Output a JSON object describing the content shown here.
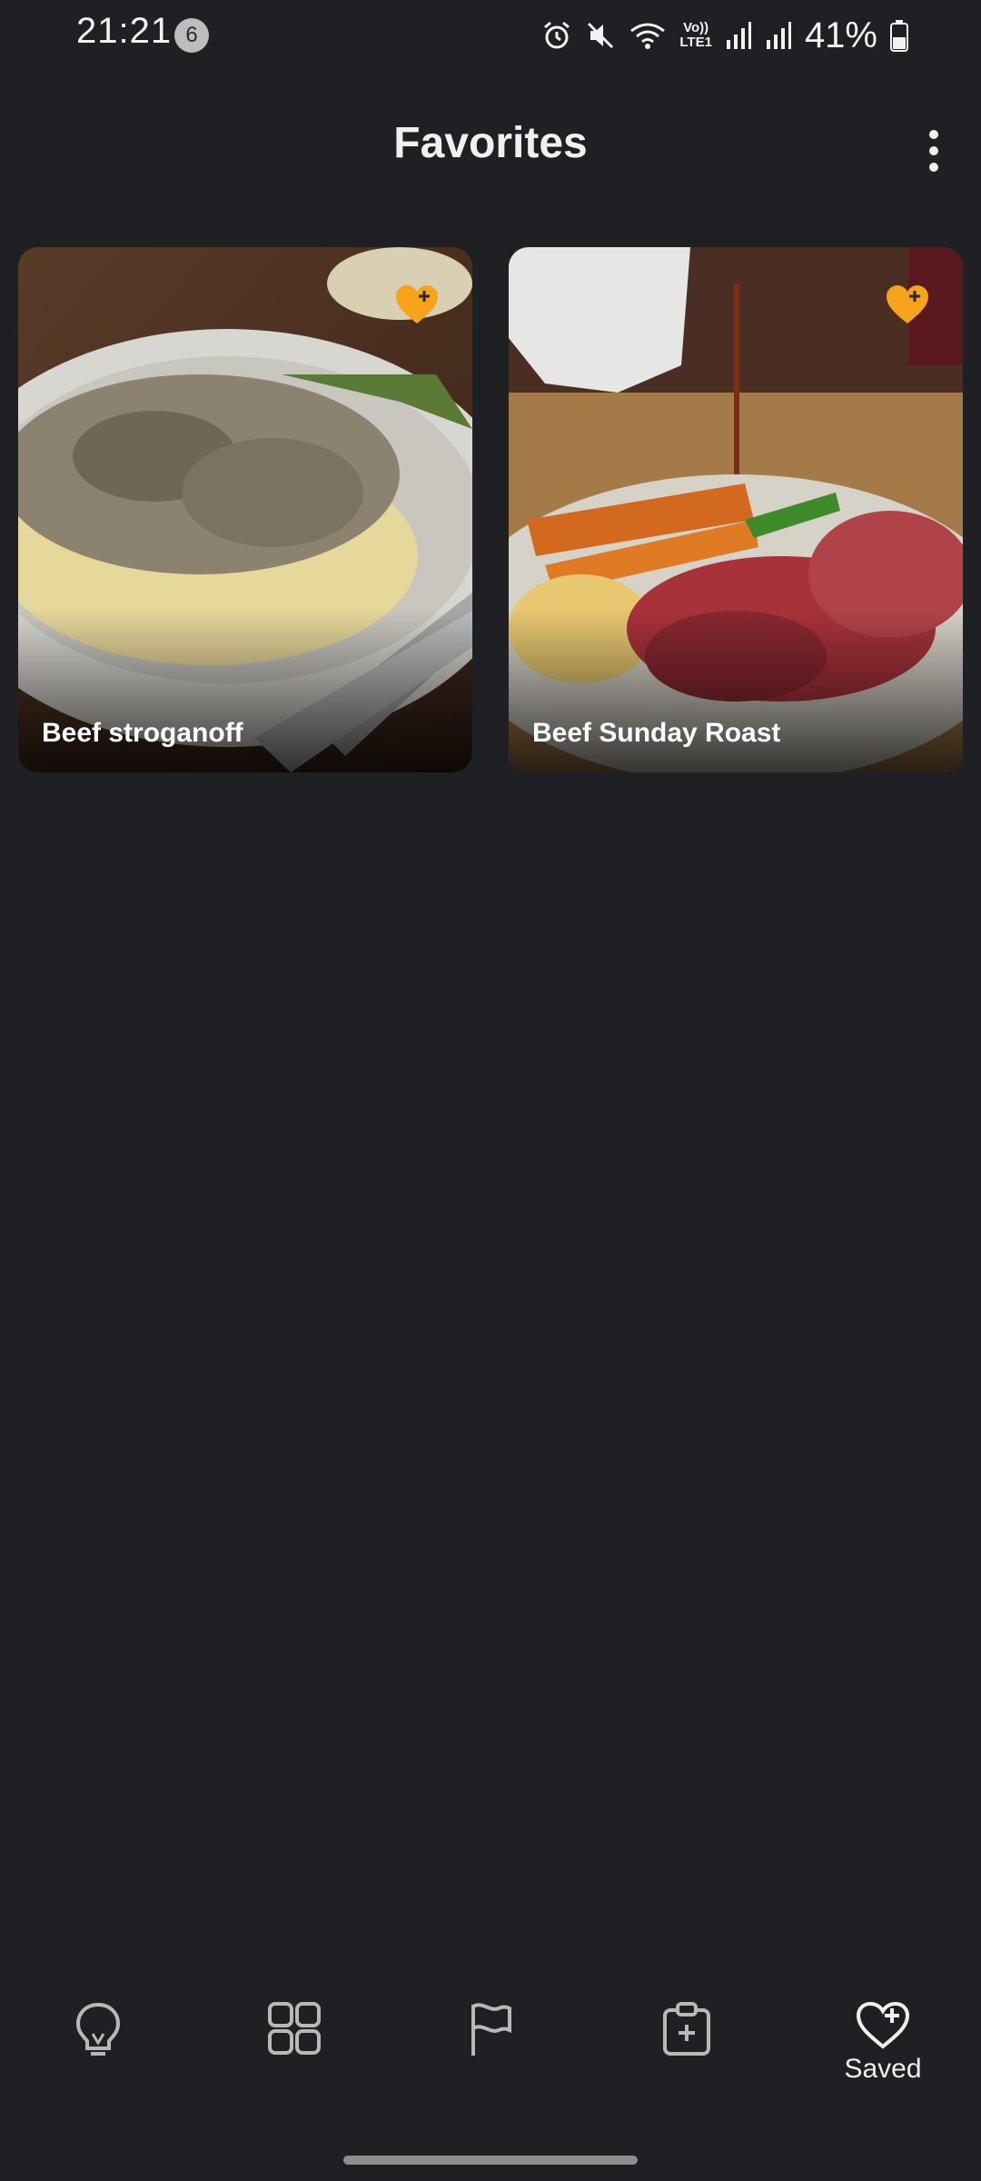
{
  "status_bar": {
    "time": "21:21",
    "notification_count": "6",
    "network_label_top": "Vo))",
    "network_label_bottom": "LTE1",
    "battery": "41%"
  },
  "header": {
    "title": "Favorites"
  },
  "recipes": [
    {
      "title": "Beef stroganoff"
    },
    {
      "title": "Beef Sunday Roast"
    }
  ],
  "bottom_nav": {
    "items": [
      {
        "icon": "lightbulb-icon",
        "label": ""
      },
      {
        "icon": "grid-icon",
        "label": ""
      },
      {
        "icon": "flag-icon",
        "label": ""
      },
      {
        "icon": "clipboard-add-icon",
        "label": ""
      },
      {
        "icon": "heart-add-icon",
        "label": "Saved"
      }
    ]
  },
  "colors": {
    "background": "#1f2024",
    "accent": "#f7a21b",
    "text": "#f0f0f0"
  }
}
